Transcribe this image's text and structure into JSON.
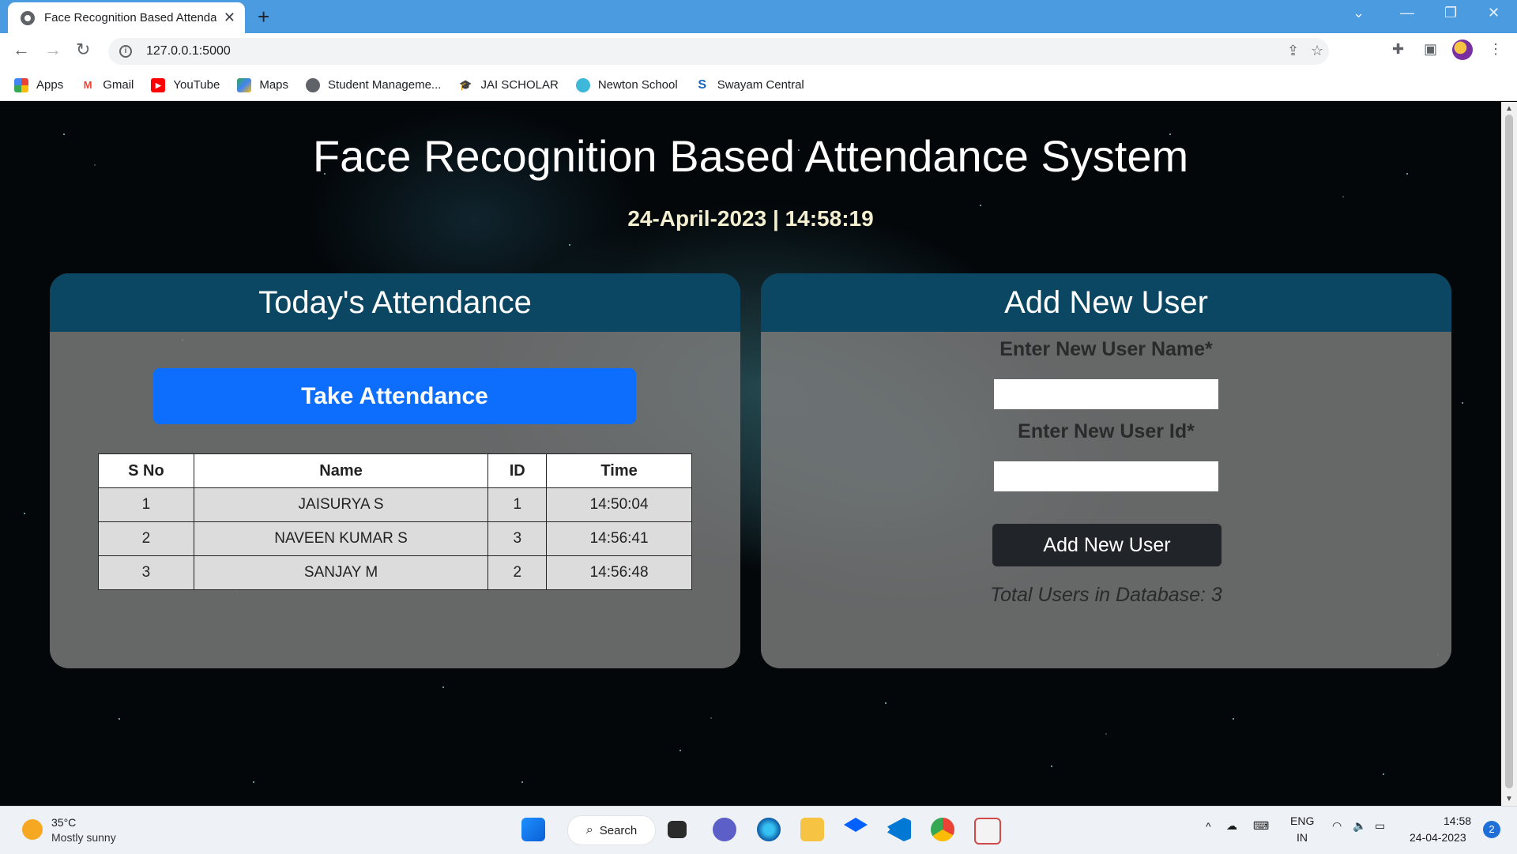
{
  "browser": {
    "tab_title": "Face Recognition Based Attendance",
    "url": "127.0.0.1:5000",
    "bookmarks": [
      {
        "label": "Apps",
        "icon": "apps-grid-icon"
      },
      {
        "label": "Gmail",
        "icon": "gmail-icon"
      },
      {
        "label": "YouTube",
        "icon": "youtube-icon"
      },
      {
        "label": "Maps",
        "icon": "maps-icon"
      },
      {
        "label": "Student Manageme...",
        "icon": "globe-icon"
      },
      {
        "label": "JAI SCHOLAR",
        "icon": "graduation-cap-icon"
      },
      {
        "label": "Newton School",
        "icon": "newton-icon"
      },
      {
        "label": "Swayam Central",
        "icon": "swayam-icon"
      }
    ]
  },
  "page": {
    "title": "Face Recognition Based Attendance System",
    "datetime": "24-April-2023 | 14:58:19"
  },
  "attendance": {
    "heading": "Today's Attendance",
    "button_label": "Take Attendance",
    "columns": [
      "S No",
      "Name",
      "ID",
      "Time"
    ],
    "rows": [
      [
        "1",
        "JAISURYA S",
        "1",
        "14:50:04"
      ],
      [
        "2",
        "NAVEEN KUMAR S",
        "3",
        "14:56:41"
      ],
      [
        "3",
        "SANJAY M",
        "2",
        "14:56:48"
      ]
    ]
  },
  "add_user": {
    "heading": "Add New User",
    "name_label": "Enter New User Name*",
    "name_value": "",
    "id_label": "Enter New User Id*",
    "id_value": "",
    "button_label": "Add New User",
    "total_text": "Total Users in Database: 3"
  },
  "taskbar": {
    "weather_temp": "35°C",
    "weather_desc": "Mostly sunny",
    "search_label": "Search",
    "lang_top": "ENG",
    "lang_bottom": "IN",
    "time": "14:58",
    "date": "24-04-2023",
    "notification_count": "2"
  },
  "colors": {
    "panel_header": "#0b4662",
    "primary_button": "#0d6efd",
    "dark_button": "#212529",
    "tabstrip": "#4a9be0"
  }
}
